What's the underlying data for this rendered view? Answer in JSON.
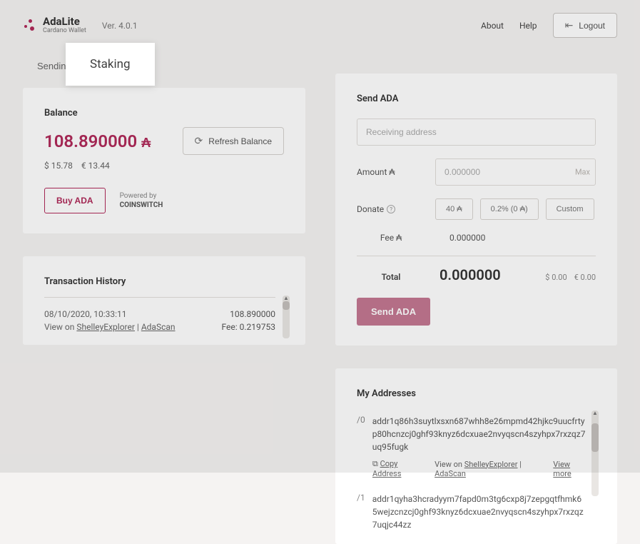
{
  "header": {
    "logo_title": "AdaLite",
    "logo_sub": "Cardano Wallet",
    "version": "Ver. 4.0.1",
    "about": "About",
    "help": "Help",
    "logout": "Logout"
  },
  "tabs": {
    "sending": "Sending",
    "staking": "Staking"
  },
  "balance": {
    "title": "Balance",
    "value": "108.890000",
    "symbol": "₳",
    "usd": "$ 15.78",
    "eur": "€ 13.44",
    "refresh": "Refresh Balance",
    "buy": "Buy ADA",
    "powered_by": "Powered by",
    "powered_brand": "COINSWITCH"
  },
  "tx": {
    "title": "Transaction History",
    "date": "08/10/2020, 10:33:11",
    "amount": "108.890000",
    "view_on": "View on ",
    "link1": "ShelleyExplorer",
    "sep": " | ",
    "link2": "AdaScan",
    "fee": "Fee: 0.219753"
  },
  "send": {
    "title": "Send ADA",
    "addr_placeholder": "Receiving address",
    "amount_label": "Amount ₳",
    "amount_placeholder": "0.000000",
    "max": "Max",
    "donate_label": "Donate",
    "donate_40": "40 ₳",
    "donate_pct": "0.2% (0 ₳)",
    "donate_custom": "Custom",
    "fee_label": "Fee ₳",
    "fee_value": "0.000000",
    "total_label": "Total",
    "total_value": "0.000000",
    "total_usd": "$ 0.00",
    "total_eur": "€ 0.00",
    "send_btn": "Send ADA"
  },
  "addr": {
    "title": "My Addresses",
    "items": [
      {
        "idx": "/0",
        "text": "addr1q86h3suytlxsxn687whh8e26mpmd42hjkc9uucfrtyp80hcnzcj0ghf93knyz6dcxuae2nvyqscn4szyhpx7rxzqz7uq95fugk"
      },
      {
        "idx": "/1",
        "text": "addr1qyha3hcradyym7fapd0m3tg6cxp8j7zepgqtfhmk65wejzcnzcj0ghf93knyz6dcxuae2nvyqscn4szyhpx7rxzqz7uqjc44zz"
      }
    ],
    "copy": "Copy Address",
    "view_on": "View on ",
    "link1": "ShelleyExplorer",
    "sep": " | ",
    "link2": "AdaScan",
    "view_more": "View more"
  }
}
